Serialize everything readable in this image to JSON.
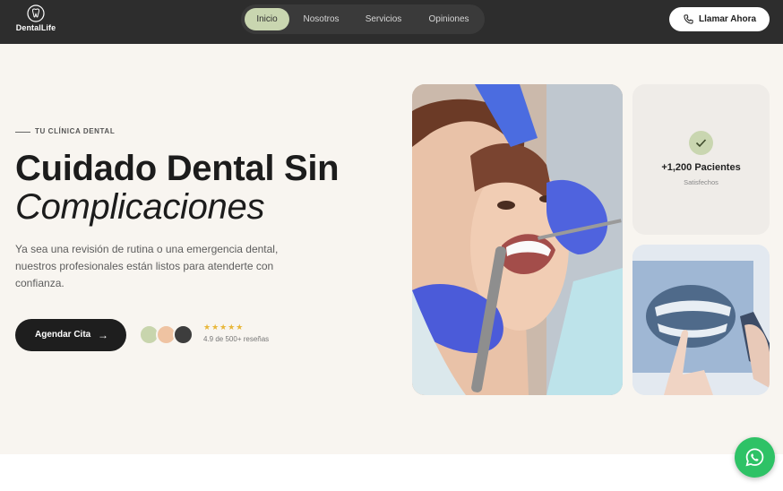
{
  "nav": {
    "brand": "DentalLife",
    "brand_icon": "tooth-icon",
    "items": [
      {
        "label": "Inicio",
        "active": true
      },
      {
        "label": "Nosotros",
        "active": false
      },
      {
        "label": "Servicios",
        "active": false
      },
      {
        "label": "Opiniones",
        "active": false
      }
    ],
    "cta_label": "Llamar Ahora",
    "cta_icon": "phone-icon"
  },
  "hero": {
    "eyebrow": "TU CLÍNICA DENTAL",
    "title_line1": "Cuidado Dental Sin",
    "title_line2": "Complicaciones",
    "lead": "Ya sea una revisión de rutina o una emergencia dental, nuestros profesionales están listos para atenderte con confianza.",
    "book_label": "Agendar Cita",
    "book_icon": "arrow-right-icon",
    "avatar_colors": [
      "#c8d5ad",
      "#efc3a2",
      "#3d3d3d"
    ],
    "stars": "★★★★★",
    "rating_text": "4.9 de 500+ reseñas"
  },
  "stats": {
    "icon": "check-icon",
    "number": "+1,200 Pacientes",
    "label": "Satisfechos"
  },
  "images": {
    "main": "dental-patient-photo",
    "secondary": "dental-xray-photo"
  },
  "floating": {
    "icon": "whatsapp-icon"
  },
  "colors": {
    "nav_bg": "#2d2d2d",
    "accent_green": "#c9d6b0",
    "hero_bg": "#f8f5f0",
    "whatsapp": "#2ec266",
    "star": "#e8b73a"
  }
}
